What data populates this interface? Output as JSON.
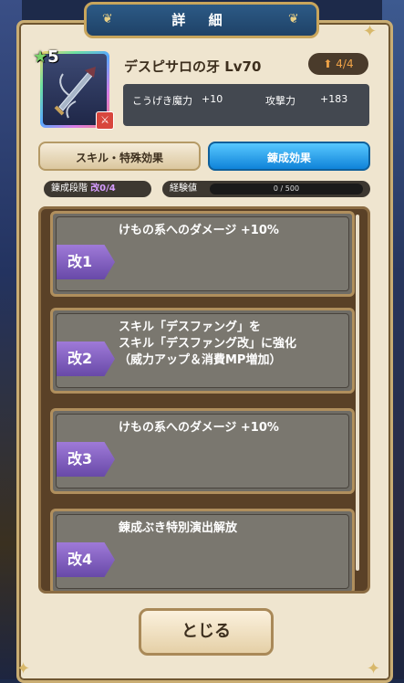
{
  "title": "詳 細",
  "weapon": {
    "name": "デスピサロの牙 Lv70",
    "rank": "5",
    "upgrade": "4/4",
    "icon": "dagger-icon"
  },
  "stats": [
    {
      "label": "こうげき魔力",
      "value": "+10"
    },
    {
      "label": "攻撃力",
      "value": "+183"
    }
  ],
  "tabs": [
    {
      "label": "スキル・特殊効果",
      "active": false
    },
    {
      "label": "錬成効果",
      "active": true
    }
  ],
  "status": {
    "rank_label": "錬成段階",
    "rank_value": "改0/4",
    "exp_label": "経験値",
    "exp_value": "0 / 500"
  },
  "items": [
    {
      "tag": "改1",
      "desc": "けもの系へのダメージ +10%"
    },
    {
      "tag": "改2",
      "desc": "スキル「デスファング」を\nスキル「デスファング改」に強化\n（威力アップ＆消費MP増加）"
    },
    {
      "tag": "改3",
      "desc": "けもの系へのダメージ +10%"
    },
    {
      "tag": "改4",
      "desc": "錬成ぶき特別演出解放"
    }
  ],
  "close_label": "とじる",
  "colors": {
    "panel_bg": "#efe5cf",
    "title_bg": "#2c5a86",
    "active_tab": "#0f83d9",
    "tag": "#7b5cc4",
    "upgrade_arrow": "#f0a347"
  }
}
